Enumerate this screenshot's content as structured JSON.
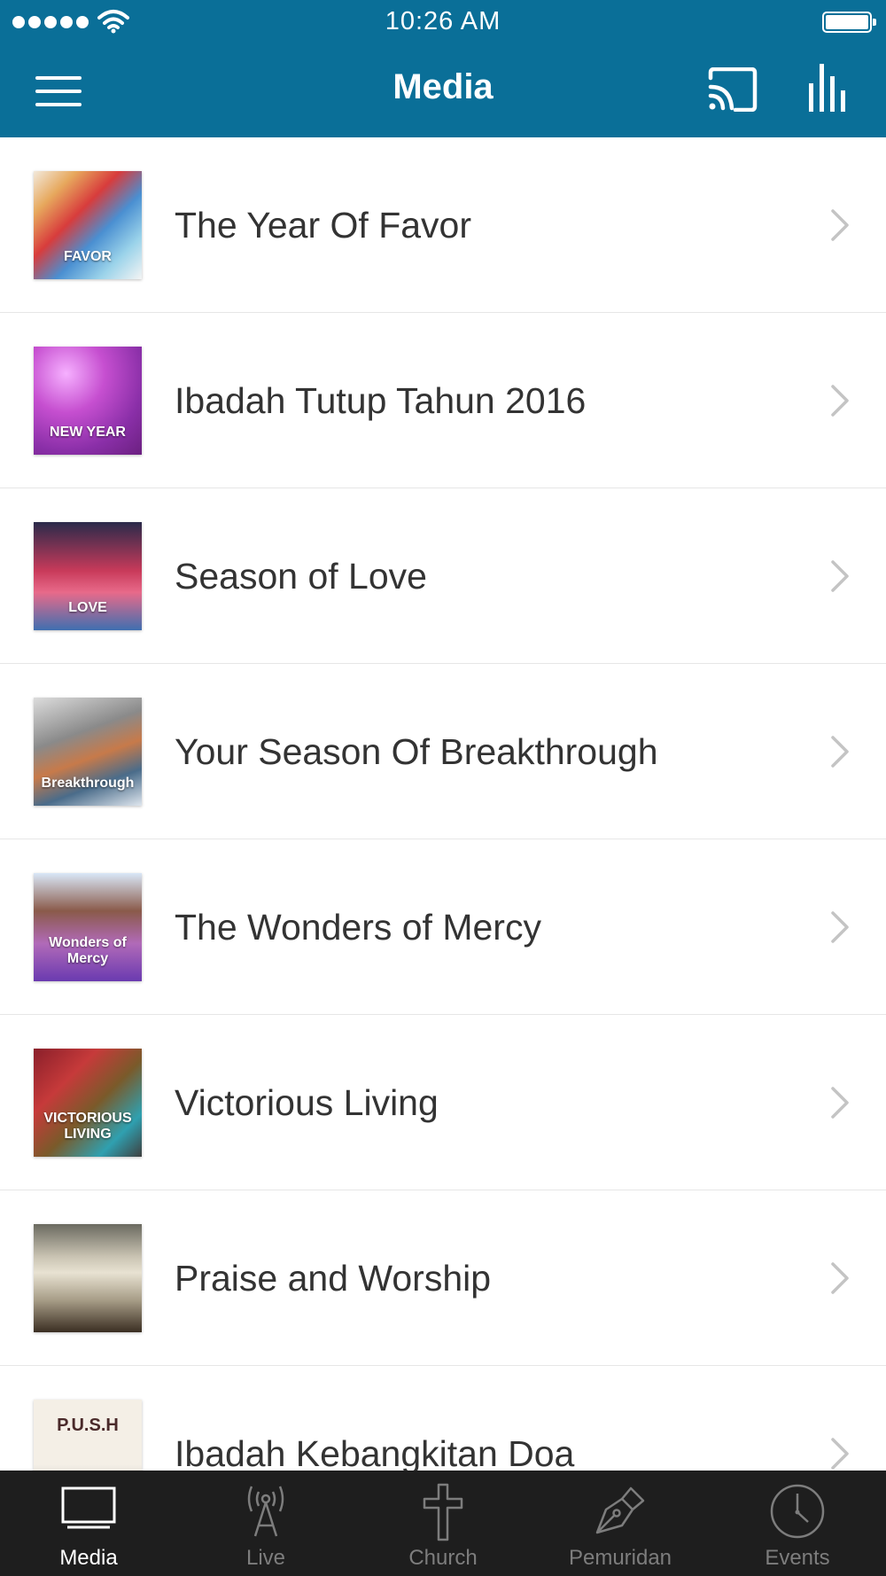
{
  "status_bar": {
    "time": "10:26 AM"
  },
  "nav": {
    "title": "Media",
    "bar_color": "#0a6f98"
  },
  "media_list": [
    {
      "title": "The Year Of Favor",
      "thumb_text": "FAVOR"
    },
    {
      "title": "Ibadah Tutup Tahun 2016",
      "thumb_text": "NEW YEAR"
    },
    {
      "title": "Season of Love",
      "thumb_text": "LOVE"
    },
    {
      "title": "Your Season Of Breakthrough",
      "thumb_text": "Breakthrough"
    },
    {
      "title": "The Wonders of Mercy",
      "thumb_text": "Wonders of Mercy"
    },
    {
      "title": "Victorious Living",
      "thumb_text": "VICTORIOUS LIVING"
    },
    {
      "title": "Praise and Worship",
      "thumb_text": ""
    },
    {
      "title": "Ibadah Kebangkitan Doa",
      "thumb_text": "P.U.S.H"
    }
  ],
  "tab_bar": {
    "tabs": [
      {
        "label": "Media",
        "icon": "tv-icon",
        "active": true
      },
      {
        "label": "Live",
        "icon": "broadcast-tower-icon",
        "active": false
      },
      {
        "label": "Church",
        "icon": "cross-icon",
        "active": false
      },
      {
        "label": "Pemuridan",
        "icon": "pen-nib-icon",
        "active": false
      },
      {
        "label": "Events",
        "icon": "clock-icon",
        "active": false
      }
    ]
  }
}
